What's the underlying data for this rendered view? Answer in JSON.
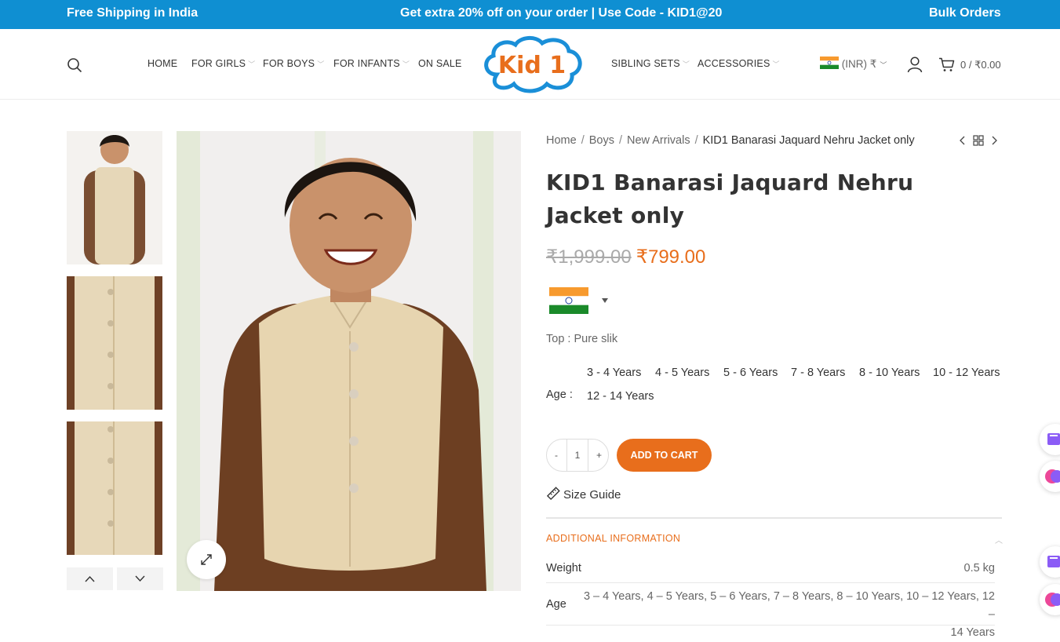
{
  "topbar": {
    "left": "Free Shipping in India",
    "center": "Get extra 20% off on your order | Use Code - KID1@20",
    "right": "Bulk Orders"
  },
  "nav": {
    "left": [
      {
        "label": "HOME",
        "has_dropdown": false
      },
      {
        "label": "FOR GIRLS",
        "has_dropdown": true
      },
      {
        "label": "FOR BOYS",
        "has_dropdown": true
      },
      {
        "label": "FOR INFANTS",
        "has_dropdown": true
      },
      {
        "label": "ON SALE",
        "has_dropdown": false
      }
    ],
    "right": [
      {
        "label": "SIBLING SETS",
        "has_dropdown": true
      },
      {
        "label": "ACCESSORIES",
        "has_dropdown": true
      }
    ],
    "logo_text": "Kid 1",
    "currency": "(INR) ₹",
    "cart": "0 / ₹0.00"
  },
  "breadcrumb": {
    "items": [
      "Home",
      "Boys",
      "New Arrivals"
    ],
    "current": "KID1 Banarasi Jaquard Nehru Jacket only"
  },
  "product": {
    "title": "KID1 Banarasi Jaquard Nehru Jacket only",
    "old_price": "₹1,999.00",
    "price": "₹799.00",
    "material": "Top : Pure slik",
    "age_label": "Age",
    "age_options": [
      "3 - 4 Years",
      "4 - 5 Years",
      "5 - 6 Years",
      "7 - 8 Years",
      "8 - 10 Years",
      "10 - 12 Years",
      "12 - 14 Years"
    ],
    "quantity": "1",
    "qty_minus": "-",
    "qty_plus": "+",
    "add_to_cart": "ADD TO CART",
    "size_guide": "Size Guide"
  },
  "additional_info": {
    "heading": "ADDITIONAL INFORMATION",
    "weight_label": "Weight",
    "weight_value": "0.5 kg",
    "age_label": "Age",
    "age_value_line1": "3 – 4 Years, 4 – 5 Years, 5 – 6 Years, 7 – 8 Years, 8 – 10 Years, 10 – 12 Years, 12 –",
    "age_value_line2": "14 Years"
  },
  "colors": {
    "topbar": "#0f8fd2",
    "accent": "#e86e1c",
    "logo_blue": "#1a8fd8"
  }
}
